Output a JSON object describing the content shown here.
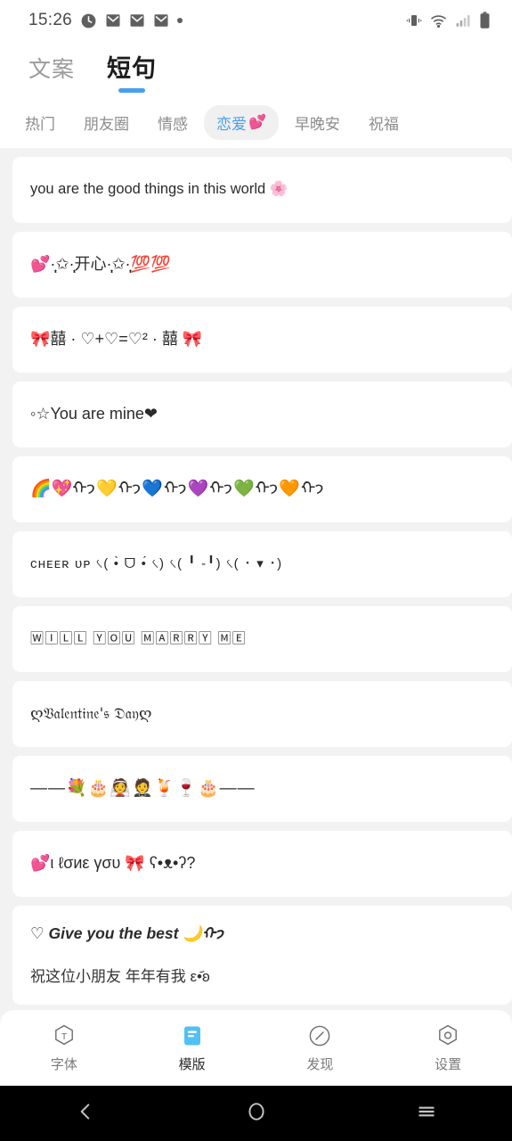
{
  "status_bar": {
    "time": "15:26",
    "left_icons": [
      "clock-icon",
      "mail-icon",
      "mail-icon",
      "mail-icon",
      "dot-icon"
    ],
    "right_icons": [
      "vibrate-icon",
      "wifi-icon",
      "signal-icon",
      "battery-icon"
    ]
  },
  "top_tabs": {
    "items": [
      {
        "label": "文案",
        "active": false
      },
      {
        "label": "短句",
        "active": true
      }
    ],
    "accent_color": "#4a9eef"
  },
  "categories": {
    "items": [
      {
        "label": "热门",
        "emoji": "",
        "active": false
      },
      {
        "label": "朋友圈",
        "emoji": "",
        "active": false
      },
      {
        "label": "情感",
        "emoji": "",
        "active": false
      },
      {
        "label": "恋爱",
        "emoji": "💕",
        "active": true
      },
      {
        "label": "早晚安",
        "emoji": "",
        "active": false
      },
      {
        "label": "祝福",
        "emoji": "",
        "active": false
      }
    ],
    "active_bg": "#f0f0f0",
    "active_color": "#4a9eef"
  },
  "cards": [
    {
      "lines": [
        "you are the good things in this world 🌸"
      ],
      "style": ""
    },
    {
      "lines": [
        "💕·̩͙✩·̩͙开心·̩͙✩·̩͙💯💯"
      ],
      "style": "big"
    },
    {
      "lines": [
        "🎀囍 · ♡+♡=♡² · 囍 🎀"
      ],
      "style": "big"
    },
    {
      "lines": [
        "◦☆You are mine❤"
      ],
      "style": "big"
    },
    {
      "lines": [
        "🌈💖ᡣ𐭩💛ᡣ𐭩💙ᡣ𐭩💜ᡣ𐭩💚ᡣ𐭩🧡ᡣ𐭩"
      ],
      "style": "emoji-row"
    },
    {
      "lines": [
        "ᴄʜᴇᴇʀ ᴜᴘ ৻( •̀ ᗜ •́ ৻) ৻( ╹ -╹) ৻( ･ ▾ ･)"
      ],
      "style": "spaced"
    },
    {
      "lines": [
        "🅆🄸🄻🄻 🅈🄾🅄 🄼🄰🅁🅁🅈 🄼🄴"
      ],
      "style": "spaced"
    },
    {
      "lines": [
        "ღ𝔙𝔞𝔩𝔢𝔫𝔱𝔦𝔫𝔢'𝔰 𝔇𝔞𝔶ღ"
      ],
      "style": "serif"
    },
    {
      "lines": [
        "——💐🎂👰🤵🍹🍷🎂——"
      ],
      "style": "emoji-row"
    },
    {
      "lines": [
        "💕ι ℓσиε γσυ 🎀 ʕ•ᴥ•ʔ?"
      ],
      "style": "big"
    },
    {
      "lines": [
        "♡ Give you the best 🌙ᡣ𐭩",
        "祝这位小朋友 年年有我 ε•᷄ʚ"
      ],
      "style": "two-line"
    }
  ],
  "bottom_nav": {
    "items": [
      {
        "label": "字体",
        "icon": "font-hexagon-icon",
        "active": false
      },
      {
        "label": "模版",
        "icon": "template-document-icon",
        "active": true
      },
      {
        "label": "发现",
        "icon": "discover-compass-icon",
        "active": false
      },
      {
        "label": "设置",
        "icon": "settings-hexagon-icon",
        "active": false
      }
    ],
    "active_color": "#4a9eef"
  },
  "system_bar": {
    "buttons": [
      {
        "name": "back-button",
        "icon": "chevron-left-icon"
      },
      {
        "name": "home-button",
        "icon": "circle-icon"
      },
      {
        "name": "recents-button",
        "icon": "hamburger-icon"
      }
    ]
  }
}
